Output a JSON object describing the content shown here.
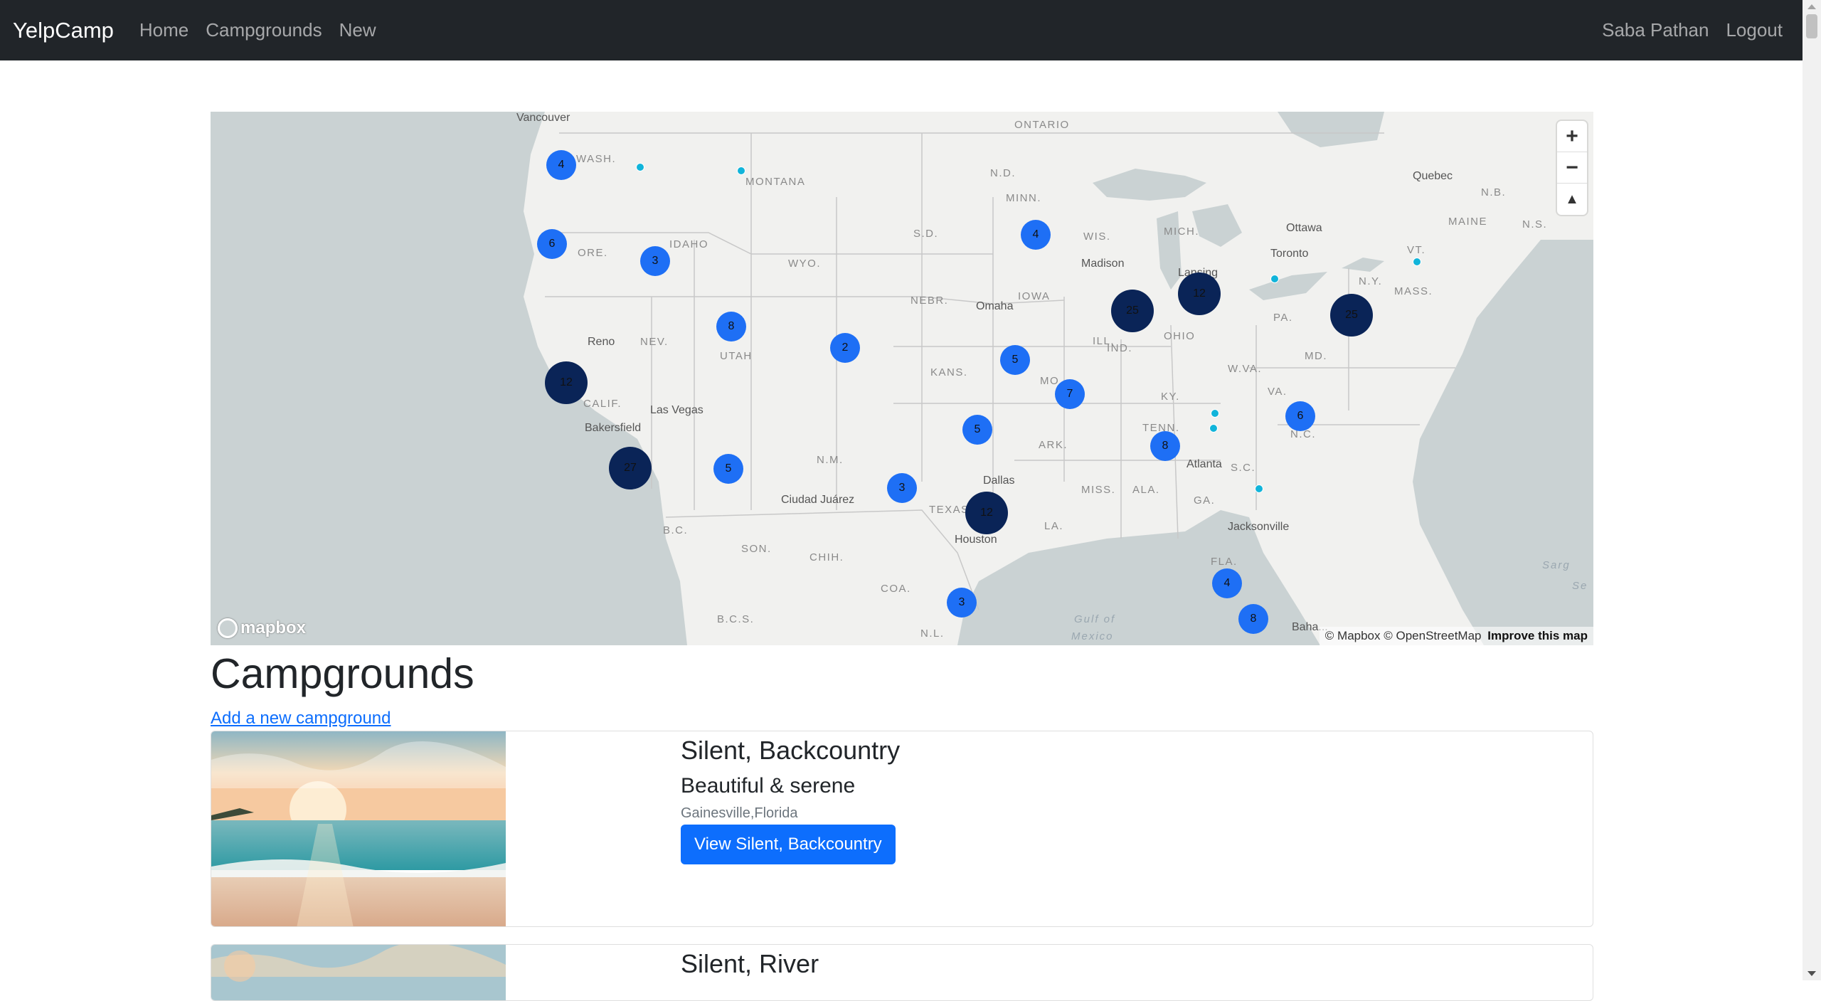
{
  "navbar": {
    "brand": "YelpCamp",
    "links": [
      "Home",
      "Campgrounds",
      "New"
    ],
    "user": "Saba Pathan",
    "logout": "Logout"
  },
  "map": {
    "region_labels": [
      {
        "text": "ONTARIO"
      },
      {
        "text": "WASH."
      },
      {
        "text": "MONTANA"
      },
      {
        "text": "N.D."
      },
      {
        "text": "MINN."
      },
      {
        "text": "N.B."
      },
      {
        "text": "N.S."
      },
      {
        "text": "MAINE"
      },
      {
        "text": "IDAHO"
      },
      {
        "text": "ORE."
      },
      {
        "text": "WYO."
      },
      {
        "text": "S.D."
      },
      {
        "text": "WIS."
      },
      {
        "text": "MICH."
      },
      {
        "text": "VT."
      },
      {
        "text": "N.Y."
      },
      {
        "text": "MASS."
      },
      {
        "text": "NEBR."
      },
      {
        "text": "IOWA"
      },
      {
        "text": "NEV."
      },
      {
        "text": "UTAH"
      },
      {
        "text": "ILL."
      },
      {
        "text": "IND."
      },
      {
        "text": "OHIO"
      },
      {
        "text": "PA."
      },
      {
        "text": "MD."
      },
      {
        "text": "KANS."
      },
      {
        "text": "MO."
      },
      {
        "text": "CALIF."
      },
      {
        "text": "W.VA."
      },
      {
        "text": "VA."
      },
      {
        "text": "KY."
      },
      {
        "text": "TENN."
      },
      {
        "text": "N.C."
      },
      {
        "text": "ARK."
      },
      {
        "text": "N.M."
      },
      {
        "text": "S.C."
      },
      {
        "text": "MISS."
      },
      {
        "text": "ALA."
      },
      {
        "text": "GA."
      },
      {
        "text": "TEXAS"
      },
      {
        "text": "LA."
      },
      {
        "text": "B.C."
      },
      {
        "text": "SON."
      },
      {
        "text": "CHIH."
      },
      {
        "text": "FLA."
      },
      {
        "text": "COA."
      },
      {
        "text": "B.C.S."
      },
      {
        "text": "N.L."
      }
    ],
    "cities": [
      {
        "text": "Vancouver"
      },
      {
        "text": "Quebec"
      },
      {
        "text": "Ottawa"
      },
      {
        "text": "Toronto"
      },
      {
        "text": "Madison"
      },
      {
        "text": "Lansing"
      },
      {
        "text": "Omaha"
      },
      {
        "text": "Reno"
      },
      {
        "text": "Las Vegas"
      },
      {
        "text": "Bakersfield"
      },
      {
        "text": "Dallas"
      },
      {
        "text": "Atlanta"
      },
      {
        "text": "Ciudad Juárez"
      },
      {
        "text": "Houston"
      },
      {
        "text": "Jacksonville"
      },
      {
        "text": "Baha..."
      }
    ],
    "water_labels": [
      {
        "text": "Gulf of"
      },
      {
        "text": "Mexico"
      },
      {
        "text": "Sarg"
      },
      {
        "text": "Se"
      }
    ],
    "clusters": [
      {
        "count": "4",
        "size": "small"
      },
      {
        "count": "6",
        "size": "small"
      },
      {
        "count": "3",
        "size": "small"
      },
      {
        "count": "4",
        "size": "small"
      },
      {
        "count": "8",
        "size": "small"
      },
      {
        "count": "2",
        "size": "small"
      },
      {
        "count": "25",
        "size": "large"
      },
      {
        "count": "12",
        "size": "large"
      },
      {
        "count": "25",
        "size": "large"
      },
      {
        "count": "12",
        "size": "large"
      },
      {
        "count": "5",
        "size": "small"
      },
      {
        "count": "7",
        "size": "small"
      },
      {
        "count": "6",
        "size": "small"
      },
      {
        "count": "5",
        "size": "small"
      },
      {
        "count": "8",
        "size": "small"
      },
      {
        "count": "27",
        "size": "large"
      },
      {
        "count": "5",
        "size": "small"
      },
      {
        "count": "3",
        "size": "small"
      },
      {
        "count": "12",
        "size": "large"
      },
      {
        "count": "4",
        "size": "small"
      },
      {
        "count": "3",
        "size": "small"
      },
      {
        "count": "8",
        "size": "small"
      }
    ],
    "single_points": 7,
    "controls": {
      "zoom_in": "+",
      "zoom_out": "−",
      "compass": "▲"
    },
    "logo": "mapbox",
    "attribution": "© Mapbox © OpenStreetMap",
    "improve": "Improve this map",
    "colors": {
      "land": "#f1f1ef",
      "water": "#cad2d3",
      "cluster_small": "#1e6ff5",
      "cluster_large": "#0a2457",
      "point": "#11b4da"
    }
  },
  "page": {
    "title": "Campgrounds",
    "add_link": "Add a new campground"
  },
  "campgrounds": [
    {
      "title": "Silent, Backcountry",
      "subtitle": "Beautiful & serene",
      "location": "Gainesville,Florida",
      "button": "View Silent, Backcountry"
    },
    {
      "title": "Silent, River"
    }
  ]
}
